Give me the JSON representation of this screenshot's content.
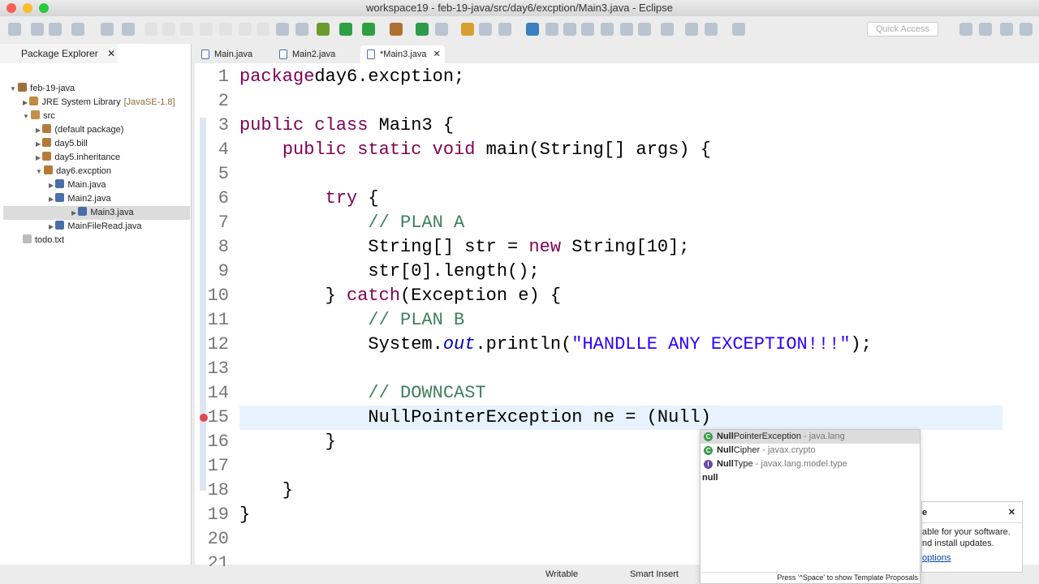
{
  "window": {
    "title": "workspace19 - feb-19-java/src/day6/excption/Main3.java - Eclipse"
  },
  "toolbar": {
    "quick_access": "Quick Access"
  },
  "explorer": {
    "title": "Package Explorer",
    "items": [
      {
        "label": "feb-19-java",
        "depth": 0,
        "icon": "project-icon"
      },
      {
        "label": "JRE System Library",
        "suffix": "[JavaSE-1.8]",
        "depth": 1,
        "icon": "library-icon"
      },
      {
        "label": "src",
        "depth": 1,
        "icon": "folder-icon"
      },
      {
        "label": "(default package)",
        "depth": 2,
        "icon": "package-icon"
      },
      {
        "label": "day5.bill",
        "depth": 2,
        "icon": "package-icon"
      },
      {
        "label": "day5.inheritance",
        "depth": 2,
        "icon": "package-icon"
      },
      {
        "label": "day6.excption",
        "depth": 2,
        "icon": "package-icon"
      },
      {
        "label": "Main.java",
        "depth": 3,
        "icon": "java-file-icon"
      },
      {
        "label": "Main2.java",
        "depth": 3,
        "icon": "java-file-icon"
      },
      {
        "label": "Main3.java",
        "depth": 3,
        "icon": "java-file-icon",
        "selected": true
      },
      {
        "label": "MainFileRead.java",
        "depth": 3,
        "icon": "java-file-icon"
      },
      {
        "label": "todo.txt",
        "depth": 1,
        "icon": "text-file-icon"
      }
    ]
  },
  "editor": {
    "tabs": [
      {
        "label": "Main.java"
      },
      {
        "label": "Main2.java"
      },
      {
        "label": "*Main3.java",
        "active": true
      }
    ],
    "lines": [
      [
        [
          "kw",
          "package"
        ],
        [
          "",
          "day6.excption;"
        ]
      ],
      [],
      [
        [
          "kw",
          "public class"
        ],
        [
          "",
          " Main3 {"
        ]
      ],
      [
        [
          "",
          "    "
        ],
        [
          "kw",
          "public static void"
        ],
        [
          "",
          " main(String[] args) {"
        ]
      ],
      [],
      [
        [
          "",
          "        "
        ],
        [
          "kw",
          "try"
        ],
        [
          "",
          " {"
        ]
      ],
      [
        [
          "cm",
          "            // PLAN A"
        ]
      ],
      [
        [
          "",
          "            String[] str = "
        ],
        [
          "kw",
          "new"
        ],
        [
          "",
          " String[10];"
        ]
      ],
      [
        [
          "",
          "            str[0].length();"
        ]
      ],
      [
        [
          "",
          "        } "
        ],
        [
          "kw",
          "catch"
        ],
        [
          "",
          "(Exception e) {"
        ]
      ],
      [
        [
          "cm",
          "            // PLAN B"
        ]
      ],
      [
        [
          "",
          "            System."
        ],
        [
          "it",
          "out"
        ],
        [
          "",
          ".println("
        ],
        [
          "st",
          "\"HANDLLE ANY EXCEPTION!!!\""
        ],
        [
          "",
          ");"
        ]
      ],
      [],
      [
        [
          "cm",
          "            // DOWNCAST"
        ]
      ],
      [
        [
          "",
          "            NullPointerException ne = (Null)"
        ]
      ],
      [
        [
          "",
          "        }"
        ]
      ],
      [],
      [
        [
          "",
          "    }"
        ]
      ],
      [
        [
          "",
          "}"
        ]
      ],
      [],
      []
    ]
  },
  "autocomplete": {
    "items": [
      {
        "match": "Null",
        "rest": "PointerException",
        "pkg": " - java.lang",
        "icon": "class-icon"
      },
      {
        "match": "Null",
        "rest": "Cipher",
        "pkg": " - javax.crypto",
        "icon": "class-icon"
      },
      {
        "match": "Null",
        "rest": "Type",
        "pkg": " - javax.lang.model.type",
        "icon": "interface-icon"
      },
      {
        "match": "null",
        "rest": "",
        "pkg": "",
        "icon": ""
      }
    ],
    "hint": "Press '^Space' to show Template Proposals"
  },
  "notification": {
    "title": "e",
    "line1": "able for your software.",
    "line2": "nd install updates.",
    "link": "options"
  },
  "status": {
    "writable": "Writable",
    "insert_mode": "Smart Insert"
  }
}
